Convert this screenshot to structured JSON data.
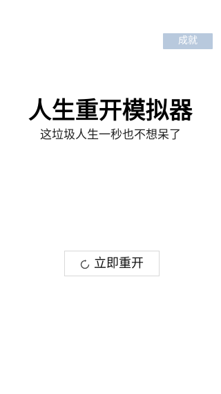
{
  "header": {
    "achievement_label": "成就"
  },
  "main": {
    "title": "人生重开模拟器",
    "subtitle": "这垃圾人生一秒也不想呆了",
    "restart_label": "立即重开",
    "restart_icon": "refresh-icon"
  },
  "colors": {
    "achievement_bg": "#b8c9dd",
    "background": "#ffffff",
    "text": "#000000"
  }
}
